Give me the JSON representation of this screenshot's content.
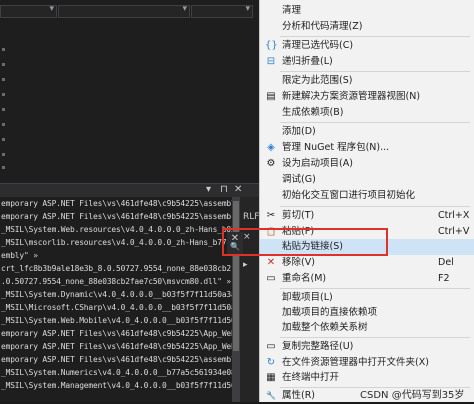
{
  "editor": {
    "toolbar_dropdowns": [
      "",
      "",
      ""
    ]
  },
  "output_panel": {
    "header_buttons": [
      "▾",
      "⊓",
      "✕"
    ],
    "lines": [
      "emporary ASP.NET Files\\vs\\461dfe48\\c9b54225\\assembl",
      "emporary ASP.NET Files\\vs\\461dfe48\\c9b54225\\assemb",
      "_MSIL\\System.Web.resources\\v4.0_4.0.0.0_zh-Hans_b03",
      "_MSIL\\mscorlib.resources\\v4.0_4.0.0.0_zh-Hans_b77a5",
      "embly\" »",
      "crt_lfc8b3b9ale18e3b_8.0.50727.9554_none_88e038cb2",
      ".0.50727.9554_none_88e038cb2fae7c50\\msvcm80.dll\" » E",
      "_MSIL\\System.Dynamic\\v4.0_4.0.0.0__b03f5f7f11d50a3a",
      "_MSIL\\Microsoft.CSharp\\v4.0_4.0.0.0__b03f5f7f11d50a3",
      "_MSIL\\System.Web.Mobile\\v4.0_4.0.0.0__b03f5f7f11d50a",
      "emporary ASP.NET Files\\vs\\461dfe48\\c9b54225\\App_Web",
      "emporary ASP.NET Files\\vs\\461dfe48\\c9b54225\\App_Web",
      "emporary ASP.NET Files\\vs\\461dfe48\\c9b54225\\assembl",
      "_MSIL\\System.Numerics\\v4.0_4.0.0.0__b77a5c561934e089",
      "_MSIL\\System.Management\\v4.0_4.0.0.0__b03f5f7f11d50a"
    ],
    "side_labels": [
      "RLF",
      "×",
      "▸"
    ]
  },
  "menu": {
    "items": [
      {
        "label": "清理",
        "icon": "",
        "shortcut": ""
      },
      {
        "label": "分析和代码清理(Z)",
        "icon": "",
        "shortcut": ""
      },
      {
        "label": "清理已选代码(C)",
        "icon": "{}",
        "shortcut": ""
      },
      {
        "label": "递归折叠(L)",
        "icon": "⊟",
        "shortcut": ""
      },
      {
        "label": "限定为此范围(S)",
        "icon": "",
        "shortcut": ""
      },
      {
        "label": "新建解决方案资源管理器视图(N)",
        "icon": "▤",
        "shortcut": ""
      },
      {
        "label": "生成依赖项(B)",
        "icon": "",
        "shortcut": ""
      },
      {
        "label": "添加(D)",
        "icon": "",
        "shortcut": ""
      },
      {
        "label": "管理 NuGet 程序包(N)...",
        "icon": "◈",
        "shortcut": ""
      },
      {
        "label": "设为启动项目(A)",
        "icon": "⚙",
        "shortcut": ""
      },
      {
        "label": "调试(G)",
        "icon": "",
        "shortcut": ""
      },
      {
        "label": "初始化交互窗口进行项目初始化",
        "icon": "",
        "shortcut": ""
      },
      {
        "label": "剪切(T)",
        "icon": "✂",
        "shortcut": "Ctrl+X"
      },
      {
        "label": "粘贴(P)",
        "icon": "📋",
        "shortcut": "Ctrl+V"
      },
      {
        "label": "粘贴为链接(S)",
        "icon": "",
        "shortcut": ""
      },
      {
        "label": "移除(V)",
        "icon": "✕",
        "shortcut": "Del"
      },
      {
        "label": "重命名(M)",
        "icon": "▭",
        "shortcut": "F2"
      },
      {
        "label": "卸载项目(L)",
        "icon": "",
        "shortcut": ""
      },
      {
        "label": "加载项目的直接依赖项",
        "icon": "",
        "shortcut": ""
      },
      {
        "label": "加载整个依赖关系树",
        "icon": "",
        "shortcut": ""
      },
      {
        "label": "复制完整路径(U)",
        "icon": "▭",
        "shortcut": ""
      },
      {
        "label": "在文件资源管理器中打开文件夹(X)",
        "icon": "↻",
        "shortcut": ""
      },
      {
        "label": "在终端中打开",
        "icon": "▦",
        "shortcut": ""
      },
      {
        "label": "属性(R)",
        "icon": "🔧",
        "shortcut": ""
      }
    ]
  },
  "floating": {
    "close": "✕",
    "search": "🔍"
  },
  "watermark": "CSDN @代码写到35岁",
  "colors": {
    "highlight": "#e0302a",
    "menu_bg": "#f2f2f2",
    "editor_bg": "#1e1e1e"
  }
}
